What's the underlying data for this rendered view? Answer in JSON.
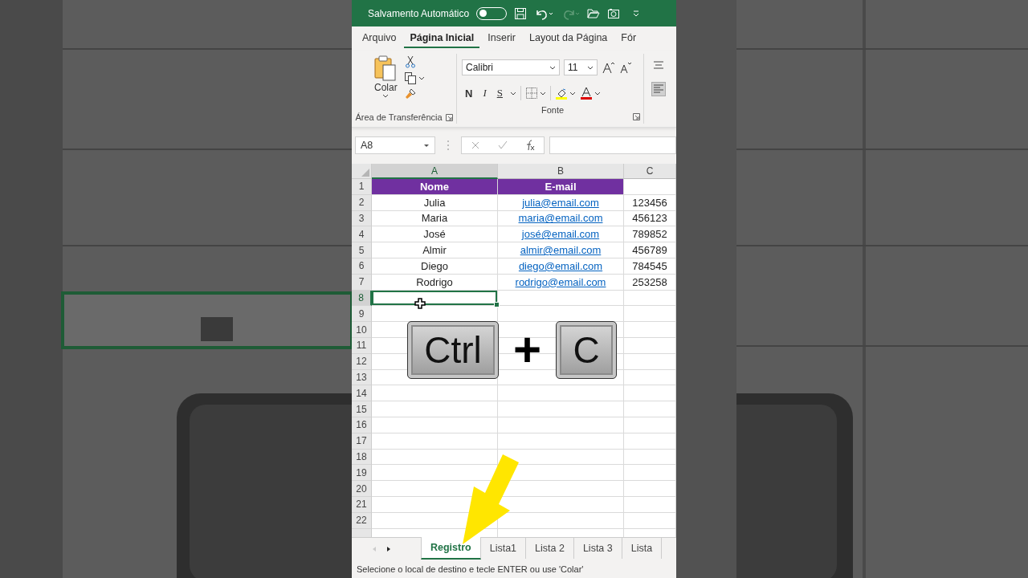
{
  "title_bar": {
    "autosave_label": "Salvamento Automático",
    "autosave_on": false
  },
  "ribbon_tabs": [
    {
      "label": "Arquivo",
      "selected": false
    },
    {
      "label": "Página Inicial",
      "selected": true
    },
    {
      "label": "Inserir",
      "selected": false
    },
    {
      "label": "Layout da Página",
      "selected": false
    },
    {
      "label": "Fór",
      "selected": false
    }
  ],
  "clipboard": {
    "paste_label": "Colar",
    "group_label": "Área de Transferência"
  },
  "font": {
    "font_name": "Calibri",
    "font_size": "11",
    "bold": "N",
    "italic": "I",
    "underline": "S",
    "group_label": "Fonte"
  },
  "formula_bar": {
    "name_box": "A8"
  },
  "grid": {
    "columns": [
      {
        "label": "A",
        "selected": true
      },
      {
        "label": "B",
        "selected": false
      },
      {
        "label": "C",
        "selected": false
      }
    ],
    "header": [
      "Nome",
      "E-mail"
    ],
    "rows": [
      {
        "name": "Julia",
        "email": "julia@email.com",
        "code": "123456"
      },
      {
        "name": "Maria",
        "email": "maria@email.com",
        "code": "456123"
      },
      {
        "name": "José",
        "email": "josé@email.com",
        "code": "789852"
      },
      {
        "name": "Almir",
        "email": "almir@email.com",
        "code": "456789"
      },
      {
        "name": "Diego",
        "email": "diego@email.com",
        "code": "784545"
      },
      {
        "name": "Rodrigo",
        "email": "rodrigo@email.com",
        "code": "253258"
      }
    ],
    "row_headers": [
      {
        "label": "1",
        "selected": false
      },
      {
        "label": "2",
        "selected": false
      },
      {
        "label": "3",
        "selected": false
      },
      {
        "label": "4",
        "selected": false
      },
      {
        "label": "5",
        "selected": false
      },
      {
        "label": "6",
        "selected": false
      },
      {
        "label": "7",
        "selected": false
      },
      {
        "label": "8",
        "selected": true
      },
      {
        "label": "9",
        "selected": false
      },
      {
        "label": "10",
        "selected": false
      },
      {
        "label": "11",
        "selected": false
      },
      {
        "label": "12",
        "selected": false
      },
      {
        "label": "13",
        "selected": false
      },
      {
        "label": "14",
        "selected": false
      },
      {
        "label": "15",
        "selected": false
      },
      {
        "label": "16",
        "selected": false
      },
      {
        "label": "17",
        "selected": false
      },
      {
        "label": "18",
        "selected": false
      },
      {
        "label": "19",
        "selected": false
      },
      {
        "label": "20",
        "selected": false
      },
      {
        "label": "21",
        "selected": false
      },
      {
        "label": "22",
        "selected": false
      }
    ]
  },
  "shortcut_overlay": {
    "first_key": "Ctrl",
    "plus": "+",
    "second_key": "C"
  },
  "sheet_tabs": [
    {
      "label": "Registro",
      "selected": true
    },
    {
      "label": "Lista1",
      "selected": false
    },
    {
      "label": "Lista 2",
      "selected": false
    },
    {
      "label": "Lista 3",
      "selected": false
    },
    {
      "label": "Lista",
      "selected": false
    }
  ],
  "status_bar": "Selecione o local de destino e tecle ENTER ou use 'Colar'"
}
